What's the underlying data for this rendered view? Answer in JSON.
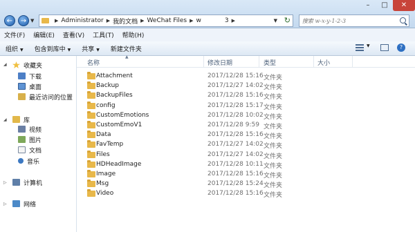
{
  "address": {
    "crumbs": [
      "Administrator",
      "我的文档",
      "WeChat Files",
      "w",
      "3"
    ]
  },
  "search": {
    "placeholder": "搜索 w-x-y-1-2-3"
  },
  "menu": [
    "文件(F)",
    "编辑(E)",
    "查看(V)",
    "工具(T)",
    "帮助(H)"
  ],
  "commands": {
    "organize": "组织",
    "include_in_library": "包含到库中",
    "share": "共享",
    "new_folder": "新建文件夹"
  },
  "sidebar": {
    "favorites": "收藏夹",
    "favorites_items": [
      "下载",
      "桌面",
      "最近访问的位置"
    ],
    "libraries": "库",
    "library_items": [
      "视频",
      "图片",
      "文档",
      "音乐"
    ],
    "computer": "计算机",
    "network": "网络"
  },
  "columns": {
    "name": "名称",
    "date": "修改日期",
    "type": "类型",
    "size": "大小"
  },
  "files": [
    {
      "name": "Attachment",
      "date": "2017/12/28 15:16",
      "type": "文件夹",
      "size": ""
    },
    {
      "name": "Backup",
      "date": "2017/12/27 14:02",
      "type": "文件夹",
      "size": ""
    },
    {
      "name": "BackupFiles",
      "date": "2017/12/28 15:16",
      "type": "文件夹",
      "size": ""
    },
    {
      "name": "config",
      "date": "2017/12/28 15:17",
      "type": "文件夹",
      "size": ""
    },
    {
      "name": "CustomEmotions",
      "date": "2017/12/28 10:02",
      "type": "文件夹",
      "size": ""
    },
    {
      "name": "CustomEmoV1",
      "date": "2017/12/28 9:59",
      "type": "文件夹",
      "size": ""
    },
    {
      "name": "Data",
      "date": "2017/12/28 15:16",
      "type": "文件夹",
      "size": ""
    },
    {
      "name": "FavTemp",
      "date": "2017/12/27 14:02",
      "type": "文件夹",
      "size": ""
    },
    {
      "name": "Files",
      "date": "2017/12/27 14:02",
      "type": "文件夹",
      "size": ""
    },
    {
      "name": "HDHeadImage",
      "date": "2017/12/28 10:11",
      "type": "文件夹",
      "size": ""
    },
    {
      "name": "Image",
      "date": "2017/12/28 15:16",
      "type": "文件夹",
      "size": ""
    },
    {
      "name": "Msg",
      "date": "2017/12/28 15:24",
      "type": "文件夹",
      "size": ""
    },
    {
      "name": "Video",
      "date": "2017/12/28 15:16",
      "type": "文件夹",
      "size": ""
    }
  ]
}
